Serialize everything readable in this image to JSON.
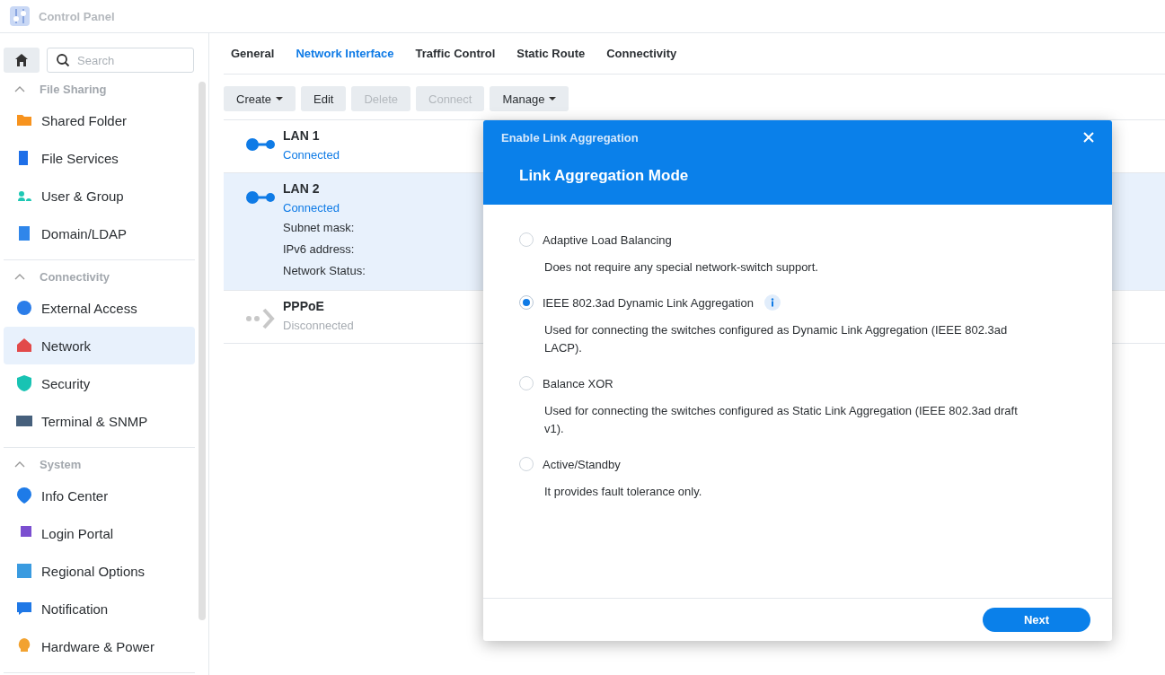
{
  "window": {
    "title": "Control Panel"
  },
  "sidebar": {
    "search": {
      "placeholder": "Search"
    },
    "groups": [
      {
        "title": "File Sharing",
        "expanded": true,
        "items": [
          {
            "label": "Shared Folder",
            "selected": false
          },
          {
            "label": "File Services",
            "selected": false
          },
          {
            "label": "User & Group",
            "selected": false
          },
          {
            "label": "Domain/LDAP",
            "selected": false
          }
        ]
      },
      {
        "title": "Connectivity",
        "expanded": true,
        "items": [
          {
            "label": "External Access",
            "selected": false
          },
          {
            "label": "Network",
            "selected": true
          },
          {
            "label": "Security",
            "selected": false
          },
          {
            "label": "Terminal & SNMP",
            "selected": false
          }
        ]
      },
      {
        "title": "System",
        "expanded": true,
        "items": [
          {
            "label": "Info Center",
            "selected": false
          },
          {
            "label": "Login Portal",
            "selected": false
          },
          {
            "label": "Regional Options",
            "selected": false
          },
          {
            "label": "Notification",
            "selected": false
          },
          {
            "label": "Hardware & Power",
            "selected": false
          }
        ]
      }
    ]
  },
  "tabs": [
    {
      "label": "General",
      "selected": false
    },
    {
      "label": "Network Interface",
      "selected": true
    },
    {
      "label": "Traffic Control",
      "selected": false
    },
    {
      "label": "Static Route",
      "selected": false
    },
    {
      "label": "Connectivity",
      "selected": false
    }
  ],
  "toolbar": [
    {
      "label": "Create",
      "dropdown": true,
      "disabled": false
    },
    {
      "label": "Edit",
      "dropdown": false,
      "disabled": false
    },
    {
      "label": "Delete",
      "dropdown": false,
      "disabled": true
    },
    {
      "label": "Connect",
      "dropdown": false,
      "disabled": true
    },
    {
      "label": "Manage",
      "dropdown": true,
      "disabled": false
    }
  ],
  "interfaces": [
    {
      "name": "LAN 1",
      "status": "Connected",
      "connected": true,
      "selected": false
    },
    {
      "name": "LAN 2",
      "status": "Connected",
      "connected": true,
      "selected": true,
      "details": [
        "Subnet mask:",
        "IPv6 address:",
        "Network Status:"
      ]
    },
    {
      "name": "PPPoE",
      "status": "Disconnected",
      "connected": false,
      "selected": false
    }
  ],
  "dialog": {
    "title": "Enable Link Aggregation",
    "heading": "Link Aggregation Mode",
    "options": [
      {
        "label": "Adaptive Load Balancing",
        "selected": false,
        "info": false,
        "description": "Does not require any special network-switch support."
      },
      {
        "label": "IEEE 802.3ad Dynamic Link Aggregation",
        "selected": true,
        "info": true,
        "description": "Used for connecting the switches configured as Dynamic Link Aggregation (IEEE 802.3ad LACP)."
      },
      {
        "label": "Balance XOR",
        "selected": false,
        "info": false,
        "description": "Used for connecting the switches configured as Static Link Aggregation (IEEE 802.3ad draft v1)."
      },
      {
        "label": "Active/Standby",
        "selected": false,
        "info": false,
        "description": "It provides fault tolerance only."
      }
    ],
    "button": "Next"
  }
}
